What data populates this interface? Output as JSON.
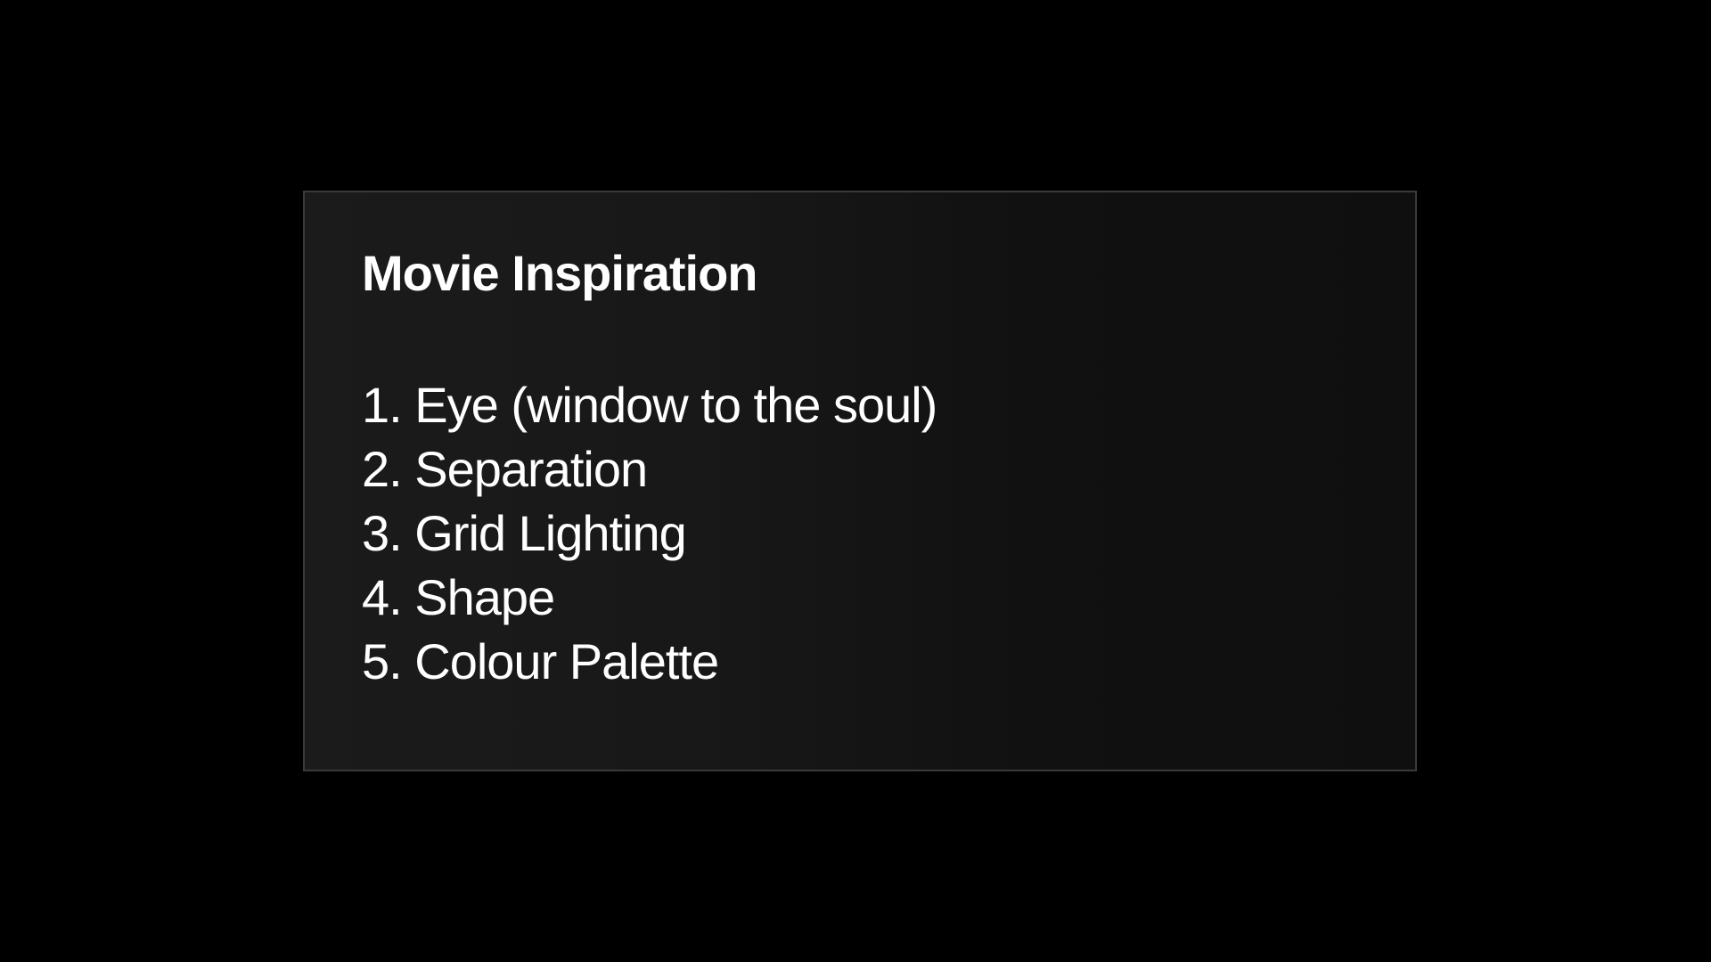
{
  "slide": {
    "title": "Movie Inspiration",
    "items": [
      "1. Eye (window to the soul)",
      "2. Separation",
      "3. Grid Lighting",
      "4. Shape",
      "5. Colour Palette"
    ]
  }
}
